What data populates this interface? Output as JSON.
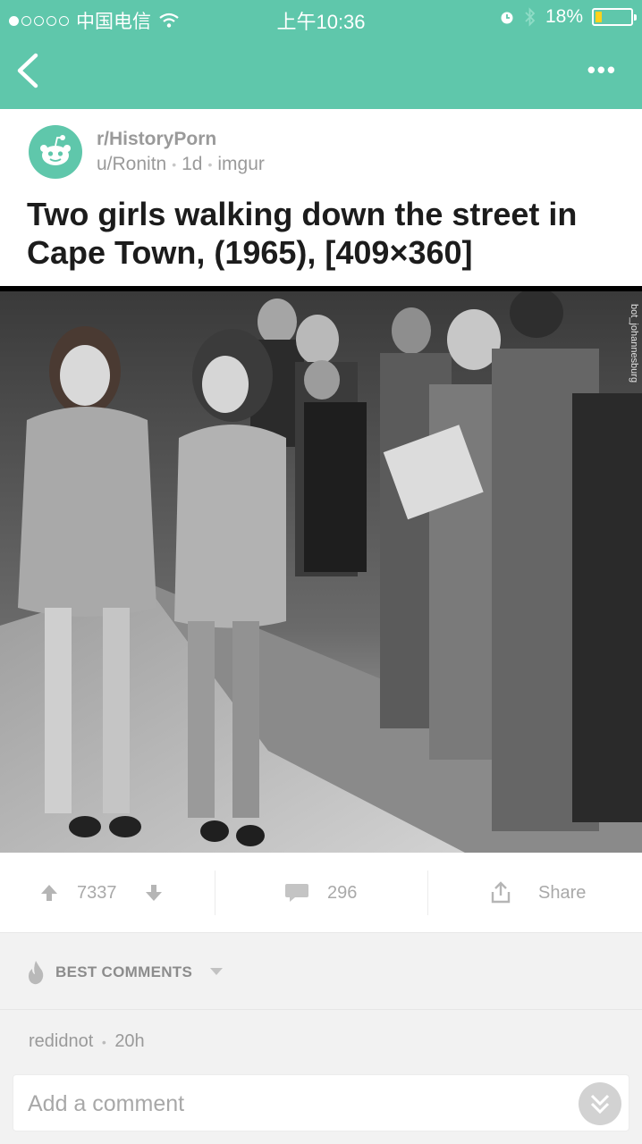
{
  "status_bar": {
    "carrier": "中国电信",
    "time": "上午10:36",
    "battery": "18%"
  },
  "post": {
    "subreddit": "r/HistoryPorn",
    "author": "u/Ronitn",
    "age": "1d",
    "domain": "imgur",
    "title": "Two girls walking down the street in Cape Town, (1965), [409×360]",
    "watermark": "bot_johannesburg"
  },
  "actions": {
    "score": "7337",
    "comments": "296",
    "share": "Share"
  },
  "comments_section": {
    "sort_label": "BEST COMMENTS",
    "first_comment_author": "redidnot",
    "first_comment_age": "20h"
  },
  "comment_input": {
    "placeholder": "Add a comment"
  },
  "colors": {
    "header": "#5fc7ab",
    "muted_text": "#9a9a9a"
  }
}
